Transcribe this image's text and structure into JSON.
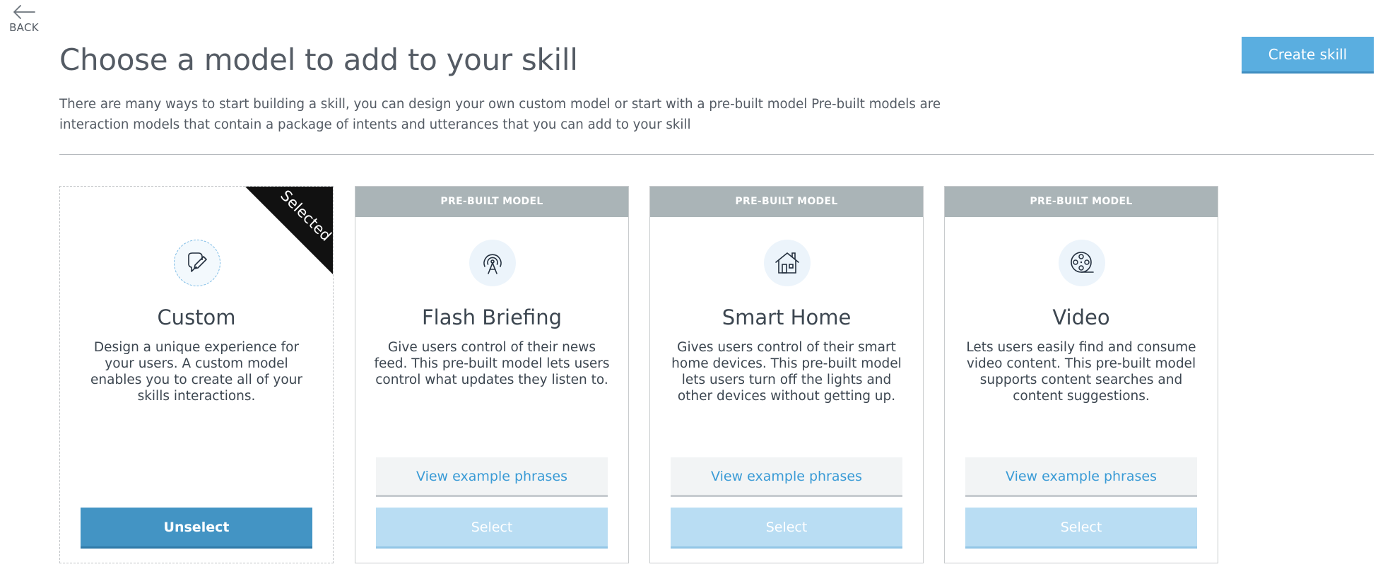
{
  "nav": {
    "back_label": "BACK"
  },
  "header": {
    "title": "Choose a model to add to your skill",
    "description": "There are many ways to start building a skill, you can design your own custom model or start with a pre-built model  Pre-built models are interaction models that contain a package of intents and utterances that you can add to your skill",
    "create_label": "Create skill"
  },
  "cards": [
    {
      "title": "Custom",
      "description": "Design a unique experience for your users. A custom model enables you to create all of your skills interactions.",
      "badge": "Selected",
      "action_label": "Unselect",
      "icon": "speech-bubble-pencil-icon"
    },
    {
      "header": "PRE-BUILT MODEL",
      "title": "Flash Briefing",
      "description": "Give users control of their news feed. This pre-built model lets users control what updates they listen to.",
      "example_label": "View example phrases",
      "action_label": "Select",
      "icon": "broadcast-tower-icon"
    },
    {
      "header": "PRE-BUILT MODEL",
      "title": "Smart Home",
      "description": "Gives users control of their smart home devices. This pre-built model lets users turn off the lights and other devices without getting up.",
      "example_label": "View example phrases",
      "action_label": "Select",
      "icon": "house-icon"
    },
    {
      "header": "PRE-BUILT MODEL",
      "title": "Video",
      "description": "Lets users easily find and consume video content. This pre-built model supports content searches and content suggestions.",
      "example_label": "View example phrases",
      "action_label": "Select",
      "icon": "film-reel-icon"
    }
  ],
  "colors": {
    "primary": "#5aaee0",
    "selected_action": "#4394c4",
    "disabled_action": "#b9ddf3",
    "card_header": "#aab4b7",
    "link": "#3a9bd6"
  }
}
